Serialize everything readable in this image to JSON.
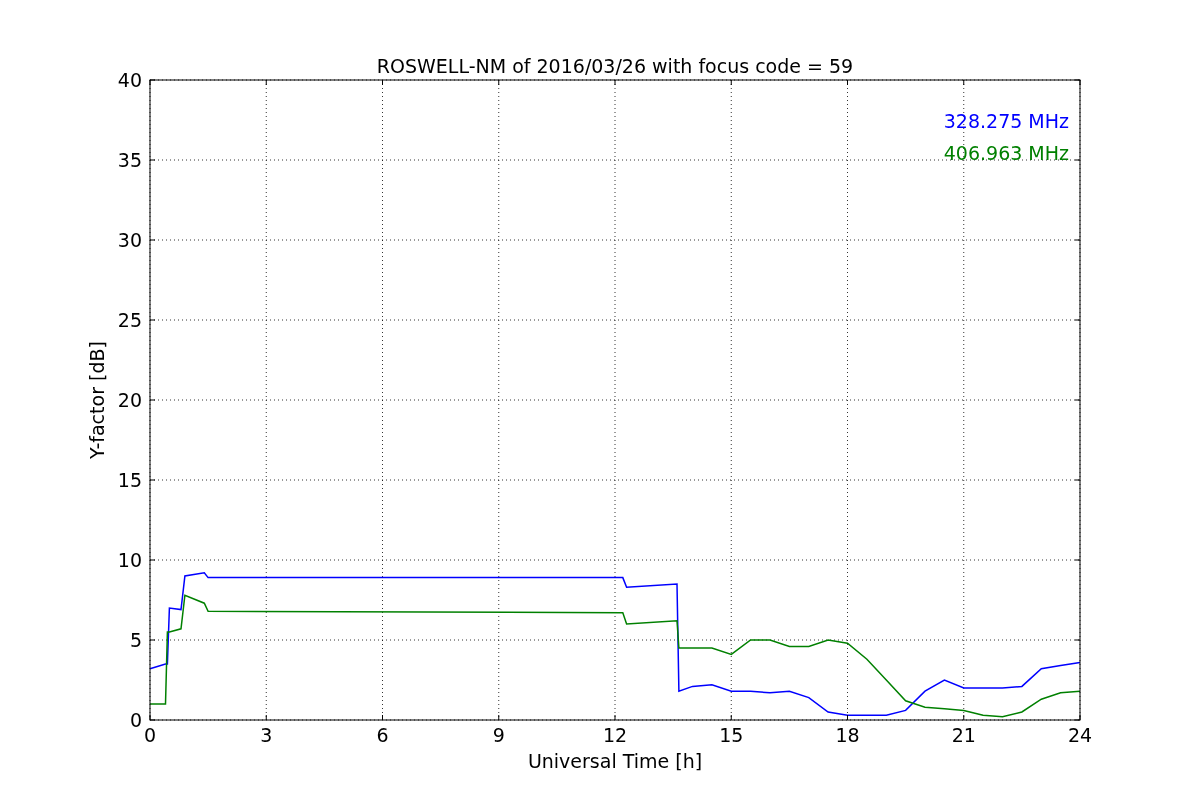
{
  "figure": {
    "chart_data": {
      "type": "line",
      "title": "ROSWELL-NM of 2016/03/26 with focus code = 59",
      "xlabel": "Universal Time [h]",
      "ylabel": "Y-factor [dB]",
      "x": [
        0,
        0.4,
        0.45,
        0.5,
        0.8,
        0.9,
        1.4,
        1.5,
        12.2,
        12.3,
        13.6,
        13.65,
        14,
        14.5,
        15,
        15.5,
        16,
        16.5,
        17,
        17.5,
        18,
        18.5,
        19,
        19.5,
        20,
        20.5,
        21,
        21.5,
        22,
        22.5,
        23,
        23.5,
        24
      ],
      "series": [
        {
          "name": "328.275 MHz",
          "color": "#0000ff",
          "values": [
            3.2,
            3.5,
            3.5,
            7.0,
            6.9,
            9.0,
            9.2,
            8.9,
            8.9,
            8.3,
            8.5,
            1.8,
            2.1,
            2.2,
            1.8,
            1.8,
            1.7,
            1.8,
            1.4,
            0.5,
            0.3,
            0.3,
            0.3,
            0.6,
            1.8,
            2.5,
            2.0,
            2.0,
            2.0,
            2.1,
            3.2,
            3.4,
            3.6
          ]
        },
        {
          "name": "406.963 MHz",
          "color": "#008000",
          "values": [
            1.0,
            1.0,
            5.5,
            5.5,
            5.7,
            7.8,
            7.3,
            6.8,
            6.7,
            6.0,
            6.2,
            4.5,
            4.5,
            4.5,
            4.1,
            5.0,
            5.0,
            4.6,
            4.6,
            5.0,
            4.8,
            3.8,
            2.5,
            1.2,
            0.8,
            0.7,
            0.6,
            0.3,
            0.2,
            0.5,
            1.3,
            1.7,
            1.8
          ]
        }
      ],
      "grid": true,
      "xlim": [
        0,
        24
      ],
      "ylim": [
        0,
        40
      ],
      "xticks": [
        0,
        3,
        6,
        9,
        12,
        15,
        18,
        21,
        24
      ],
      "yticks": [
        0,
        5,
        10,
        15,
        20,
        25,
        30,
        35,
        40
      ]
    }
  }
}
